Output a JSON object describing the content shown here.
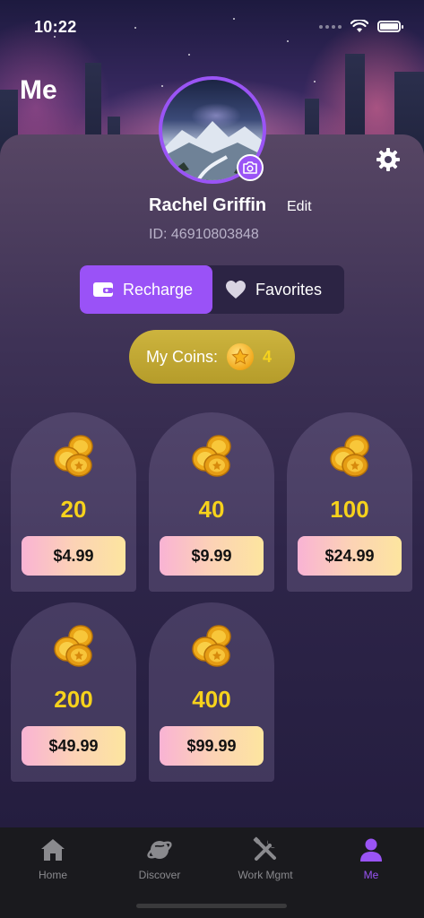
{
  "status_bar": {
    "time": "10:22"
  },
  "page": {
    "title": "Me"
  },
  "profile": {
    "name": "Rachel Griffin",
    "edit_label": "Edit",
    "id_text": "ID: 46910803848"
  },
  "tabs": [
    {
      "label": "Recharge",
      "icon": "wallet-icon",
      "active": true
    },
    {
      "label": "Favorites",
      "icon": "heart-icon",
      "active": false
    }
  ],
  "coins": {
    "label": "My Coins:",
    "value": "4",
    "icon": "star-coin-icon"
  },
  "packages": [
    {
      "amount": "20",
      "price": "$4.99",
      "icon": "coin-stack-icon"
    },
    {
      "amount": "40",
      "price": "$9.99",
      "icon": "coin-stack-icon"
    },
    {
      "amount": "100",
      "price": "$24.99",
      "icon": "coin-stack-icon"
    },
    {
      "amount": "200",
      "price": "$49.99",
      "icon": "coin-stack-icon"
    },
    {
      "amount": "400",
      "price": "$99.99",
      "icon": "coin-stack-icon"
    }
  ],
  "nav": [
    {
      "label": "Home",
      "icon": "home-icon",
      "active": false
    },
    {
      "label": "Discover",
      "icon": "planet-icon",
      "active": false
    },
    {
      "label": "Work Mgmt",
      "icon": "tools-icon",
      "active": false
    },
    {
      "label": "Me",
      "icon": "person-icon",
      "active": true
    }
  ],
  "colors": {
    "accent": "#9a54f5",
    "coin_gold": "#f6d21c",
    "price_gradient_start": "#f9b3d4",
    "price_gradient_end": "#fde59f"
  }
}
